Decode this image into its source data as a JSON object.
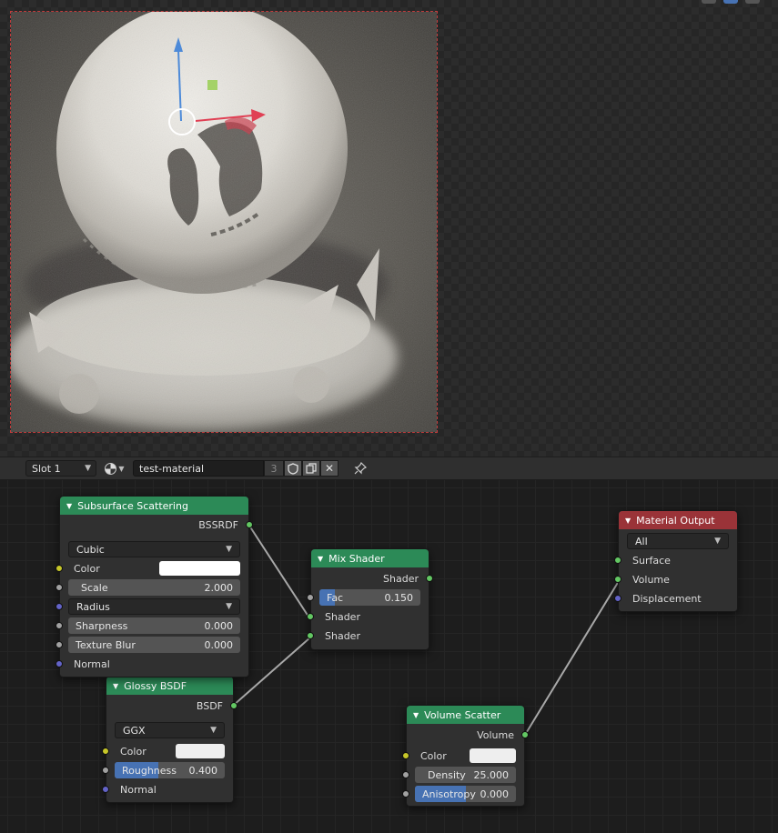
{
  "viewport": {
    "render_label": "rendered material preview"
  },
  "header": {
    "slot": "Slot 1",
    "material_name": "test-material",
    "user_count": "3"
  },
  "nodes": {
    "subsurface": {
      "title": "Subsurface Scattering",
      "output": "BSSRDF",
      "method": "Cubic",
      "color_label": "Color",
      "color_value": "#ffffff",
      "scale_label": "Scale",
      "scale_value": "2.000",
      "falloff": "Radius",
      "sharpness_label": "Sharpness",
      "sharpness_value": "0.000",
      "texture_blur_label": "Texture Blur",
      "texture_blur_value": "0.000",
      "normal_label": "Normal"
    },
    "glossy": {
      "title": "Glossy BSDF",
      "output": "BSDF",
      "distribution": "GGX",
      "color_label": "Color",
      "color_value": "#eeeeee",
      "roughness_label": "Roughness",
      "roughness_value": "0.400",
      "roughness_fraction": 0.4,
      "normal_label": "Normal"
    },
    "mix": {
      "title": "Mix Shader",
      "output": "Shader",
      "fac_label": "Fac",
      "fac_value": "0.150",
      "fac_fraction": 0.15,
      "shader1_label": "Shader",
      "shader2_label": "Shader"
    },
    "volume": {
      "title": "Volume Scatter",
      "output": "Volume",
      "color_label": "Color",
      "color_value": "#eeeeee",
      "density_label": "Density",
      "density_value": "25.000",
      "anisotropy_label": "Anisotropy",
      "anisotropy_value": "0.000",
      "anisotropy_fraction": 0.5
    },
    "output": {
      "title": "Material Output",
      "target": "All",
      "surface_label": "Surface",
      "volume_label": "Volume",
      "displacement_label": "Displacement"
    }
  },
  "colors": {
    "shader_node_header": "#2c8a57",
    "output_node_header": "#9a3338",
    "slider_fill": "#4772b3",
    "socket_shader": "#63c763",
    "socket_color": "#c7c729",
    "socket_value": "#a1a1a1",
    "socket_vector": "#6363c7"
  }
}
